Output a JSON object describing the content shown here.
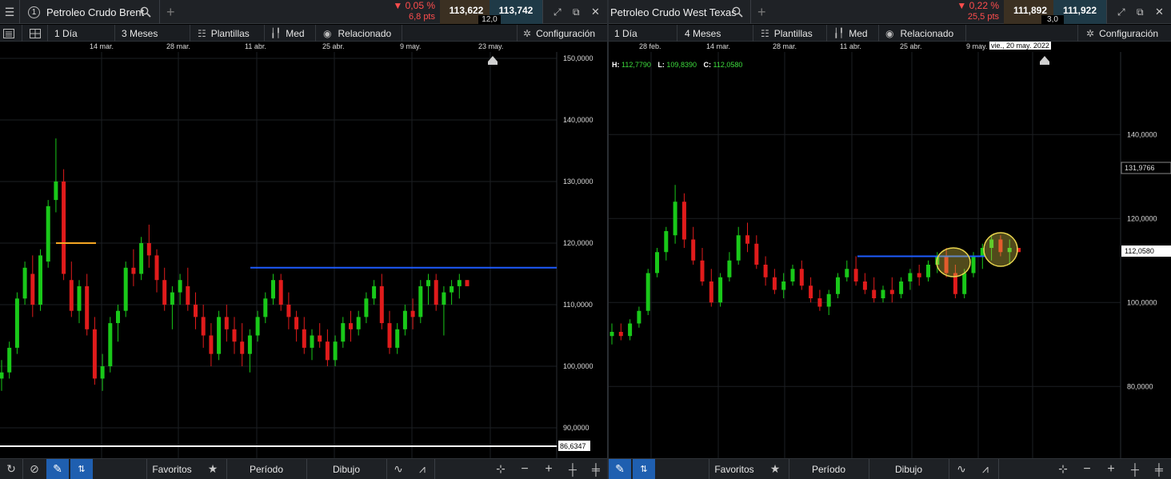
{
  "left": {
    "instrument": "Petroleo Crudo Brent",
    "change_pct": "▼ 0,05 %",
    "change_pts": "6,8 pts",
    "bid": "113,622",
    "ask": "113,742",
    "spread": "12,0",
    "toolbar": {
      "interval": "1 Día",
      "range": "3 Meses",
      "templates": "Plantillas",
      "price_mode": "Med",
      "related": "Relacionado",
      "settings": "Configuración"
    },
    "dates": [
      "14 mar.",
      "28 mar.",
      "11 abr.",
      "25 abr.",
      "9 may.",
      "23 may."
    ],
    "y_ticks": [
      "150,0000",
      "140,0000",
      "130,0000",
      "120,0000",
      "110,0000",
      "100,0000",
      "90,0000"
    ],
    "current_price_label": "86,6347",
    "bottom": {
      "favorites": "Favoritos",
      "period": "Período",
      "drawing": "Dibujo"
    }
  },
  "right": {
    "instrument": "Petroleo Crudo West Texas",
    "change_pct": "▼ 0,22 %",
    "change_pts": "25,5 pts",
    "bid": "111,892",
    "ask": "111,922",
    "spread": "3,0",
    "toolbar": {
      "interval": "1 Día",
      "range": "4 Meses",
      "templates": "Plantillas",
      "price_mode": "Med",
      "related": "Relacionado",
      "settings": "Configuración"
    },
    "dates": [
      "28 feb.",
      "14 mar.",
      "28 mar.",
      "11 abr.",
      "25 abr.",
      "9 may."
    ],
    "cursor_date": "vie., 20 may. 2022",
    "hlc": {
      "h_label": "H:",
      "h": "112,7790",
      "l_label": "L:",
      "l": "109,8390",
      "c_label": "C:",
      "c": "112,0580"
    },
    "y_ticks": [
      "140,0000",
      "120,0000",
      "100,0000",
      "80,0000"
    ],
    "crosshair_label": "131,9766",
    "last_price_label": "112,0580",
    "bottom": {
      "favorites": "Favoritos",
      "period": "Período",
      "drawing": "Dibujo"
    }
  },
  "colors": {
    "up": "#19c819",
    "down": "#e01b1b",
    "trend_blue": "#1e5cff",
    "trend_orange": "#f5a623",
    "highlight": "#e8d44d",
    "accent_blue": "#1f5fb0"
  },
  "chart_data": [
    {
      "type": "candlestick",
      "title": "Petroleo Crudo Brent",
      "ylim": [
        90,
        150
      ],
      "candles": [
        [
          98,
          101,
          96,
          99
        ],
        [
          99,
          104,
          98,
          103
        ],
        [
          103,
          112,
          102,
          111
        ],
        [
          111,
          117,
          110,
          116
        ],
        [
          115,
          118,
          108,
          110
        ],
        [
          110,
          119,
          109,
          118
        ],
        [
          117,
          127,
          116,
          126
        ],
        [
          127,
          137,
          125,
          130
        ],
        [
          130,
          132,
          114,
          115
        ],
        [
          114,
          117,
          108,
          109
        ],
        [
          109,
          114,
          107,
          113
        ],
        [
          113,
          115,
          105,
          106
        ],
        [
          106,
          108,
          97,
          98
        ],
        [
          98,
          102,
          96,
          100
        ],
        [
          100,
          108,
          99,
          107
        ],
        [
          107,
          110,
          104,
          109
        ],
        [
          109,
          117,
          108,
          116
        ],
        [
          116,
          119,
          113,
          115
        ],
        [
          115,
          121,
          114,
          120
        ],
        [
          120,
          123,
          116,
          118
        ],
        [
          118,
          119,
          112,
          114
        ],
        [
          114,
          116,
          109,
          110
        ],
        [
          110,
          113,
          106,
          112
        ],
        [
          112,
          115,
          110,
          114
        ],
        [
          113,
          116,
          109,
          110
        ],
        [
          110,
          112,
          106,
          108
        ],
        [
          108,
          110,
          103,
          105
        ],
        [
          105,
          107,
          100,
          102
        ],
        [
          102,
          109,
          101,
          108
        ],
        [
          108,
          110,
          104,
          106
        ],
        [
          106,
          108,
          102,
          104
        ],
        [
          104,
          107,
          100,
          102
        ],
        [
          102,
          106,
          99,
          105
        ],
        [
          105,
          109,
          104,
          108
        ],
        [
          108,
          112,
          107,
          111
        ],
        [
          111,
          115,
          110,
          114
        ],
        [
          114,
          115,
          109,
          110
        ],
        [
          110,
          112,
          106,
          108
        ],
        [
          108,
          109,
          104,
          106
        ],
        [
          106,
          108,
          102,
          103
        ],
        [
          103,
          106,
          101,
          105
        ],
        [
          105,
          107,
          103,
          104
        ],
        [
          104,
          106,
          100,
          101
        ],
        [
          101,
          105,
          100,
          104
        ],
        [
          104,
          108,
          103,
          107
        ],
        [
          107,
          109,
          104,
          106
        ],
        [
          106,
          109,
          105,
          108
        ],
        [
          108,
          112,
          107,
          111
        ],
        [
          111,
          114,
          110,
          113
        ],
        [
          113,
          115,
          106,
          107
        ],
        [
          107,
          109,
          102,
          103
        ],
        [
          103,
          107,
          102,
          106
        ],
        [
          106,
          110,
          105,
          109
        ],
        [
          109,
          111,
          106,
          108
        ],
        [
          108,
          114,
          107,
          113
        ],
        [
          113,
          115,
          110,
          114
        ],
        [
          114,
          115,
          109,
          110
        ],
        [
          110,
          113,
          105,
          112
        ],
        [
          112,
          114,
          110,
          113
        ],
        [
          113,
          115,
          111,
          114
        ],
        [
          114,
          114,
          113,
          113
        ]
      ]
    },
    {
      "type": "candlestick",
      "title": "Petroleo Crudo West Texas",
      "ylim": [
        72,
        150
      ],
      "candles": [
        [
          92,
          95,
          90,
          93
        ],
        [
          93,
          95,
          91,
          92
        ],
        [
          92,
          96,
          91,
          95
        ],
        [
          95,
          99,
          94,
          98
        ],
        [
          98,
          108,
          97,
          107
        ],
        [
          107,
          113,
          106,
          112
        ],
        [
          112,
          118,
          110,
          117
        ],
        [
          116,
          128,
          114,
          124
        ],
        [
          124,
          126,
          113,
          115
        ],
        [
          115,
          118,
          109,
          110
        ],
        [
          110,
          113,
          104,
          105
        ],
        [
          105,
          108,
          99,
          100
        ],
        [
          100,
          107,
          99,
          106
        ],
        [
          106,
          112,
          105,
          110
        ],
        [
          110,
          118,
          109,
          116
        ],
        [
          116,
          119,
          112,
          114
        ],
        [
          114,
          116,
          108,
          109
        ],
        [
          109,
          111,
          104,
          106
        ],
        [
          106,
          108,
          102,
          103
        ],
        [
          103,
          107,
          101,
          105
        ],
        [
          105,
          109,
          104,
          108
        ],
        [
          108,
          110,
          103,
          104
        ],
        [
          104,
          106,
          100,
          101
        ],
        [
          101,
          103,
          98,
          99
        ],
        [
          99,
          103,
          97,
          102
        ],
        [
          102,
          107,
          101,
          106
        ],
        [
          106,
          110,
          105,
          108
        ],
        [
          108,
          111,
          104,
          105
        ],
        [
          105,
          107,
          102,
          103
        ],
        [
          103,
          106,
          100,
          101
        ],
        [
          101,
          104,
          100,
          103
        ],
        [
          103,
          106,
          100,
          102
        ],
        [
          102,
          106,
          101,
          105
        ],
        [
          105,
          108,
          103,
          107
        ],
        [
          107,
          109,
          104,
          106
        ],
        [
          106,
          110,
          105,
          109
        ],
        [
          109,
          112,
          107,
          111
        ],
        [
          111,
          113,
          106,
          107
        ],
        [
          107,
          109,
          101,
          102
        ],
        [
          102,
          108,
          101,
          107
        ],
        [
          107,
          112,
          106,
          111
        ],
        [
          111,
          114,
          108,
          113
        ],
        [
          113,
          116,
          110,
          115
        ],
        [
          115,
          116,
          111,
          112
        ],
        [
          112,
          115,
          109,
          113
        ],
        [
          113,
          113,
          112,
          112
        ]
      ]
    }
  ]
}
